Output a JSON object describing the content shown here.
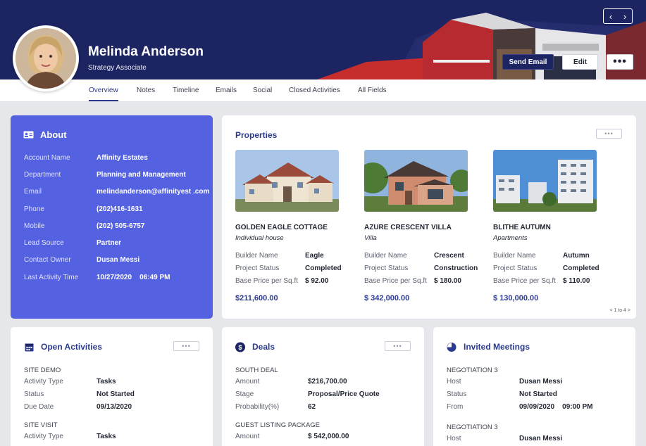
{
  "profile": {
    "name": "Melinda Anderson",
    "role": "Strategy Associate",
    "buttons": {
      "send_email": "Send Email",
      "edit": "Edit",
      "more": "•••"
    },
    "pager": {
      "prev": "‹",
      "next": "›"
    }
  },
  "tabs": [
    {
      "label": "Overview",
      "active": true
    },
    {
      "label": "Notes"
    },
    {
      "label": "Timeline"
    },
    {
      "label": "Emails"
    },
    {
      "label": "Social"
    },
    {
      "label": "Closed Activities"
    },
    {
      "label": "All Fields"
    }
  ],
  "about": {
    "title": "About",
    "rows": [
      {
        "k": "Account Name",
        "v": "Affinity Estates"
      },
      {
        "k": "Department",
        "v": "Planning and Management"
      },
      {
        "k": "Email",
        "v": "melindanderson@affinityest .com"
      },
      {
        "k": "Phone",
        "v": "(202)416-1631"
      },
      {
        "k": "Mobile",
        "v": "(202) 505-6757"
      },
      {
        "k": "Lead Source",
        "v": "Partner"
      },
      {
        "k": "Contact Owner",
        "v": "Dusan Messi"
      },
      {
        "k": "Last Activity Time",
        "v": "10/27/2020    06:49 PM"
      }
    ]
  },
  "properties": {
    "title": "Properties",
    "more": "•••",
    "pagination": "< 1 to 4 >",
    "items": [
      {
        "name": "GOLDEN EAGLE COTTAGE",
        "type": "Individual house",
        "builder_label": "Builder Name",
        "builder": "Eagle",
        "status_label": "Project Status",
        "status": "Completed",
        "base_label": "Base Price per Sq.ft",
        "base": "$ 92.00",
        "price": "$211,600.00"
      },
      {
        "name": "AZURE CRESCENT VILLA",
        "type": "Villa",
        "builder_label": "Builder Name",
        "builder": "Crescent",
        "status_label": "Project Status",
        "status": "Construction",
        "base_label": "Base Price per Sq.ft",
        "base": "$ 180.00",
        "price": "$ 342,000.00"
      },
      {
        "name": "BLITHE AUTUMN",
        "type": "Apartments",
        "builder_label": "Builder Name",
        "builder": "Autumn",
        "status_label": "Project Status",
        "status": "Completed",
        "base_label": "Base Price per Sq.ft",
        "base": "$ 110.00",
        "price": "$ 130,000.00"
      }
    ]
  },
  "open_activities": {
    "title": "Open Activities",
    "more": "•••",
    "groups": [
      {
        "section": "SITE DEMO",
        "rows": [
          {
            "k": "Activity Type",
            "v": "Tasks"
          },
          {
            "k": "Status",
            "v": "Not Started"
          },
          {
            "k": "Due Date",
            "v": "09/13/2020"
          }
        ]
      },
      {
        "section": "SITE VISIT",
        "rows": [
          {
            "k": "Activity Type",
            "v": "Tasks"
          }
        ]
      }
    ]
  },
  "deals": {
    "title": "Deals",
    "more": "•••",
    "groups": [
      {
        "section": "SOUTH DEAL",
        "rows": [
          {
            "k": "Amount",
            "v": "$216,700.00"
          },
          {
            "k": "Stage",
            "v": "Proposal/Price Quote"
          },
          {
            "k": "Probability(%)",
            "v": "62"
          }
        ]
      },
      {
        "section": "GUEST LISTING PACKAGE",
        "rows": [
          {
            "k": "Amount",
            "v": "$ 542,000.00"
          }
        ]
      }
    ]
  },
  "meetings": {
    "title": "Invited Meetings",
    "groups": [
      {
        "section": "NEGOTIATION 3",
        "rows": [
          {
            "k": "Host",
            "v": "Dusan Messi"
          },
          {
            "k": "Status",
            "v": "Not Started"
          },
          {
            "k": "From",
            "v": "09/09/2020    09:00 PM"
          }
        ]
      },
      {
        "section": "NEGOTIATION 3",
        "rows": [
          {
            "k": "Host",
            "v": "Dusan Messi"
          }
        ]
      }
    ]
  },
  "colors": {
    "banner": "#1c2462",
    "accent": "#2b3a8f",
    "about_bg": "#5461e0"
  }
}
